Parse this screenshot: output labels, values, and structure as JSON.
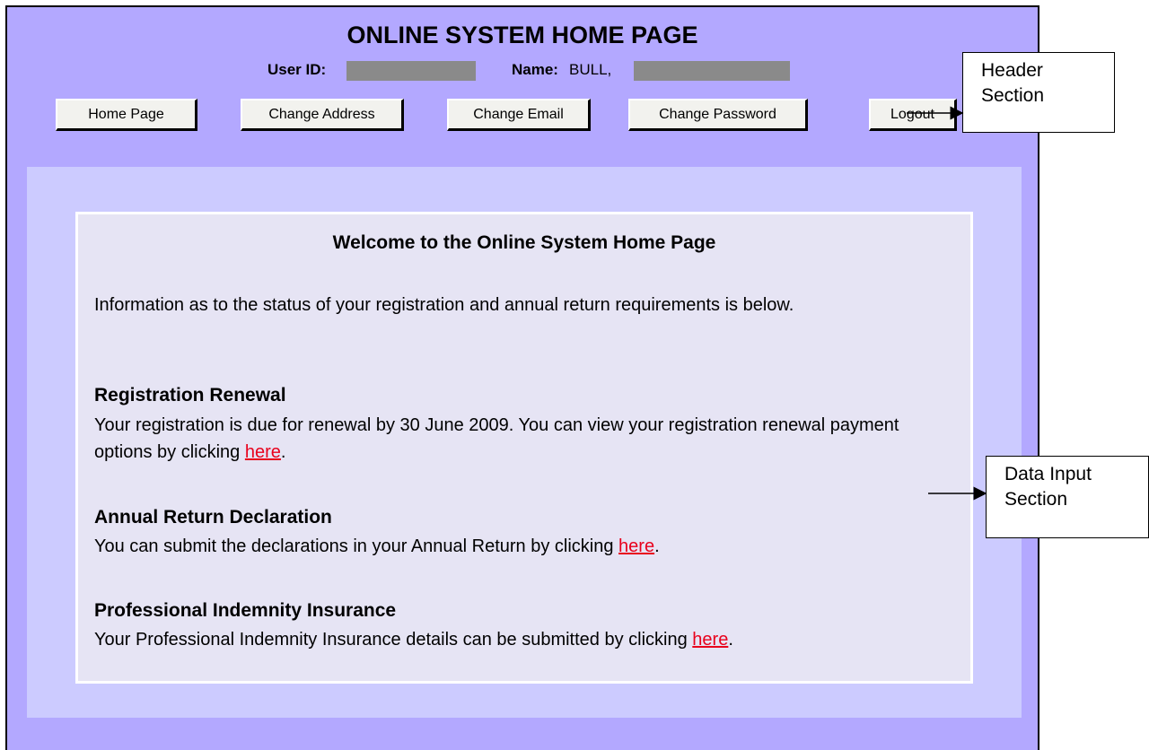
{
  "header": {
    "title": "ONLINE SYSTEM HOME PAGE",
    "user_id_label": "User ID:",
    "name_label": "Name:",
    "name_value": "BULL,"
  },
  "nav": {
    "home": "Home Page",
    "change_address": "Change Address",
    "change_email": "Change Email",
    "change_password": "Change Password",
    "logout": "Logout"
  },
  "content": {
    "welcome": "Welcome to the Online System Home Page",
    "intro": "Information as to the status of your registration and annual return requirements is below.",
    "sections": [
      {
        "heading": "Registration Renewal",
        "text": "Your registration is due for renewal by 30 June 2009. You can view your registration renewal payment options by clicking ",
        "link": "here",
        "suffix": "."
      },
      {
        "heading": "Annual Return Declaration",
        "text": "You can submit the declarations in your Annual Return by clicking ",
        "link": "here",
        "suffix": "."
      },
      {
        "heading": "Professional Indemnity Insurance",
        "text": "Your Professional Indemnity Insurance details can be submitted by clicking ",
        "link": "here",
        "suffix": "."
      }
    ]
  },
  "callouts": {
    "header_section_line1": "Header",
    "header_section_line2": "Section",
    "data_input_line1": "Data Input",
    "data_input_line2": "Section"
  },
  "colors": {
    "header_bg": "#b3a8ff",
    "outer_panel": "#cccbff",
    "inner_panel": "#e6e4f4",
    "link": "#e8001c"
  }
}
